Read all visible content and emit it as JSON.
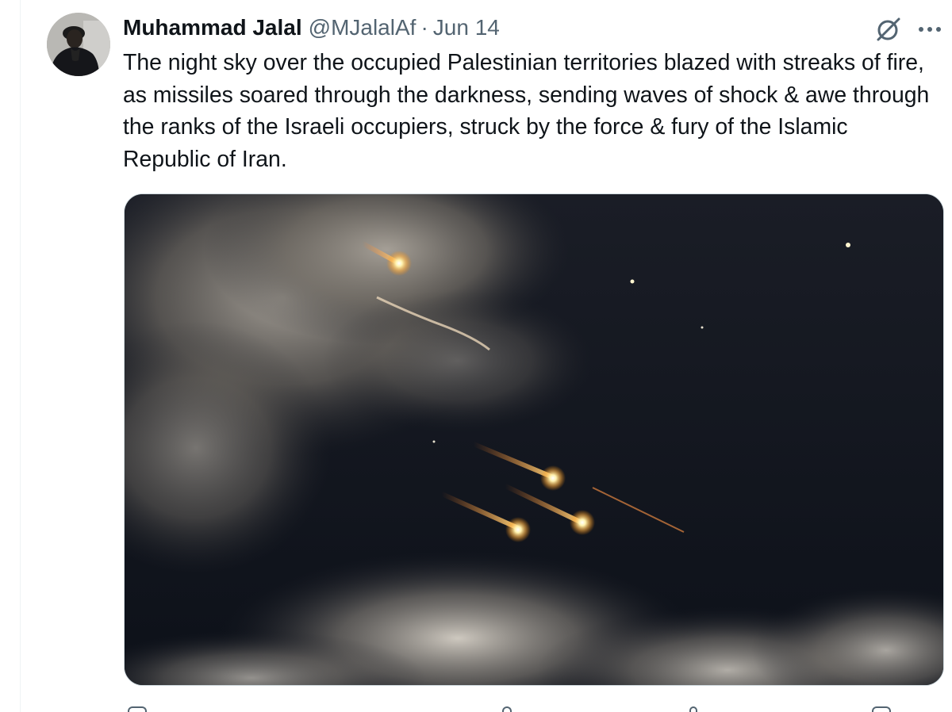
{
  "tweet": {
    "author_name": "Muhammad Jalal",
    "author_handle": "@MJalalAf",
    "separator": "·",
    "date": "Jun 14",
    "text": "The night sky over the occupied Palestinian territories blazed with streaks of fire, as missiles soared through the darkness, sending waves of shock & awe through the ranks of the Israeli occupiers, struck by the force & fury of the Islamic Republic of Iran.",
    "media_description": "night sky photo with glowing missile streaks",
    "icons": {
      "avatar": "avatar",
      "grok": "grok-icon",
      "more": "more-options-icon",
      "reply": "reply-icon",
      "retweet": "retweet-icon",
      "like": "like-icon",
      "views": "views-icon",
      "bookmark": "bookmark-icon"
    }
  },
  "colors": {
    "text_primary": "#0f1419",
    "text_secondary": "#536471",
    "border": "#cfd9de"
  }
}
